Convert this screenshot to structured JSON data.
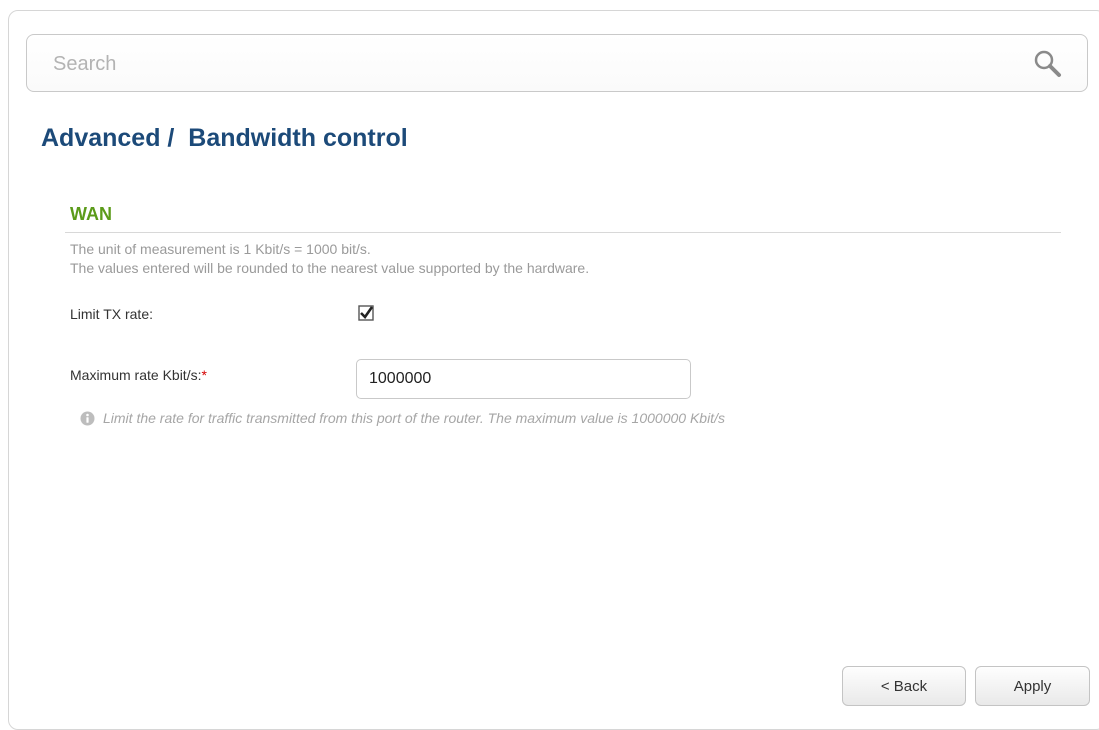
{
  "search": {
    "placeholder": "Search",
    "icon": "search-icon"
  },
  "page": {
    "title": "Advanced /  Bandwidth control"
  },
  "section": {
    "title": "WAN",
    "note_line1": "The unit of measurement is 1 Kbit/s = 1000 bit/s.",
    "note_line2": "The values entered will be rounded to the nearest value supported by the hardware."
  },
  "form": {
    "limit_tx": {
      "label": "Limit TX rate:",
      "checked": true
    },
    "max_rate": {
      "label": "Maximum rate Kbit/s:",
      "required_mark": "*",
      "value": "1000000"
    },
    "hint": {
      "icon": "info-icon",
      "text": "Limit the rate for traffic transmitted from this port of the router. The maximum value is 1000000 Kbit/s"
    }
  },
  "buttons": {
    "back": "< Back",
    "apply": "Apply"
  },
  "colors": {
    "title": "#1c4a79",
    "section": "#5b9b1a",
    "required": "#d40000",
    "muted_text": "#9a9a9a"
  }
}
